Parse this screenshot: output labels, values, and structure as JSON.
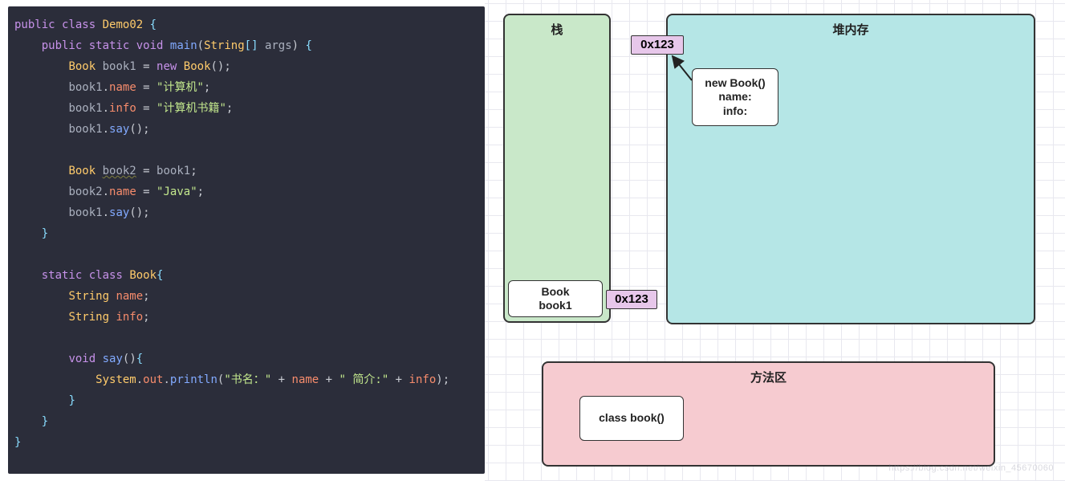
{
  "code": {
    "line1": "public class Demo02 {",
    "line2": "    public static void main(String[] args) {",
    "line3": "        Book book1 = new Book();",
    "line4": "        book1.name = \"计算机\";",
    "line5": "        book1.info = \"计算机书籍\";",
    "line6": "        book1.say();",
    "line7": "",
    "line8": "        Book book2 = book1;",
    "line9": "        book2.name = \"Java\";",
    "line10": "        book1.say();",
    "line11": "    }",
    "line12": "",
    "line13": "    static class Book{",
    "line14": "        String name;",
    "line15": "        String info;",
    "line16": "",
    "line17": "        void say(){",
    "line18": "            System.out.println(\"书名：\" + name + \" 简介:\" + info);",
    "line19": "        }",
    "line20": "    }",
    "line21": "}"
  },
  "diagram": {
    "stack_title": "栈",
    "heap_title": "堆内存",
    "method_title": "方法区",
    "heap_addr": "0x123",
    "stack_addr": "0x123",
    "stack_box_line1": "Book",
    "stack_box_line2": "book1",
    "heap_obj_line1": "new Book()",
    "heap_obj_line2": "name:",
    "heap_obj_line3": "info:",
    "method_box_text": "class book()",
    "watermark": "https://blog.csdn.net/weixin_45670060"
  }
}
